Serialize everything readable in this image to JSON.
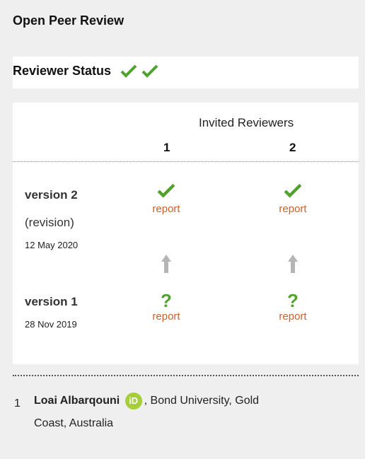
{
  "header": {
    "title": "Open Peer Review"
  },
  "status": {
    "label": "Reviewer Status"
  },
  "colors": {
    "accent_green": "#4fa22c",
    "report_orange": "#c8612b",
    "arrow_gray": "#b5b5b5"
  },
  "reviewers": {
    "heading": "Invited Reviewers",
    "columns": [
      "1",
      "2"
    ]
  },
  "versions": [
    {
      "label": "version 2",
      "note": "(revision)",
      "date": "12 May 2020",
      "reports": [
        "report",
        "report"
      ]
    },
    {
      "label": "version 1",
      "note": "",
      "date": "28 Nov 2019",
      "reports": [
        "report",
        "report"
      ]
    }
  ],
  "footer": {
    "number": "1",
    "name": "Loai Albarqouni",
    "orcid_label": "iD",
    "affiliation_a": ", Bond University, Gold",
    "affiliation_b": "Coast, Australia"
  }
}
